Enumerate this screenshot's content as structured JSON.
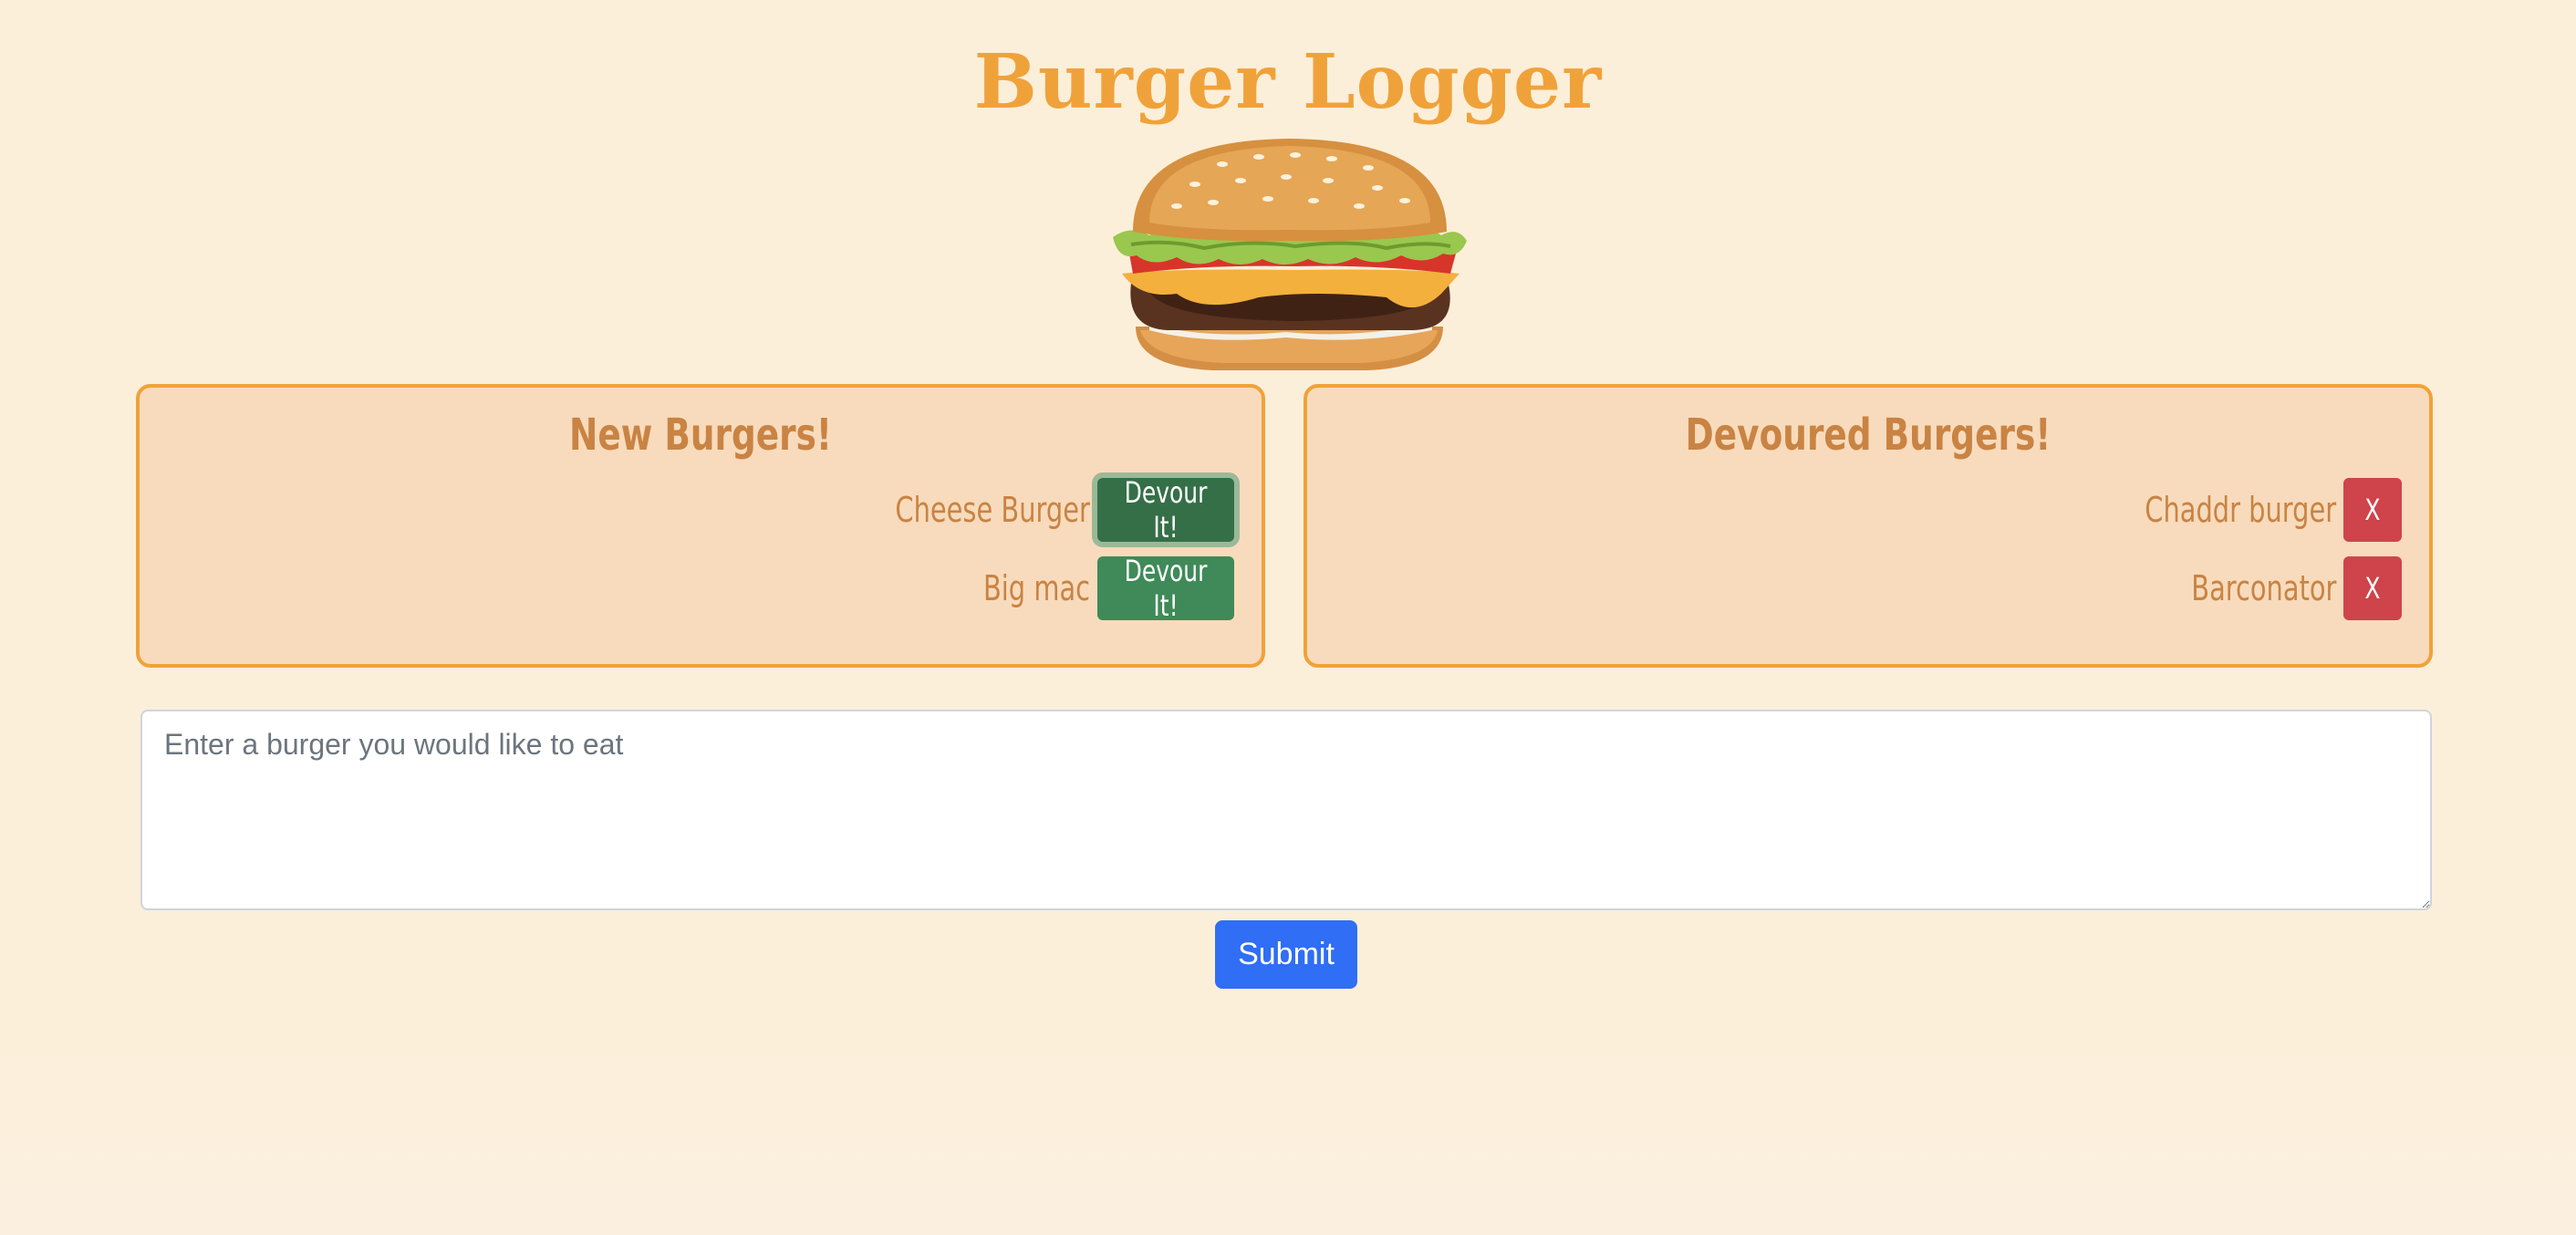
{
  "header": {
    "title": "Burger Logger"
  },
  "hero_image": {
    "alt": "cheeseburger"
  },
  "new_burgers": {
    "title": "New Burgers!",
    "items": [
      {
        "name": "Cheese Burger",
        "button_label": "Devour It!"
      },
      {
        "name": "Big mac",
        "button_label": "Devour It!"
      }
    ]
  },
  "devoured_burgers": {
    "title": "Devoured Burgers!",
    "items": [
      {
        "name": "Chaddr burger",
        "button_label": "X"
      },
      {
        "name": "Barconator",
        "button_label": "X"
      }
    ]
  },
  "form": {
    "placeholder": "Enter a burger you would like to eat",
    "value": "",
    "submit_label": "Submit"
  },
  "colors": {
    "background": "#fcefd9",
    "accent_orange": "#f0a23a",
    "panel_fill": "#f8dbbc",
    "panel_text": "#c98343",
    "devour_green": "#3f8a58",
    "delete_red": "#cf434b",
    "submit_blue": "#2f6ef5"
  }
}
